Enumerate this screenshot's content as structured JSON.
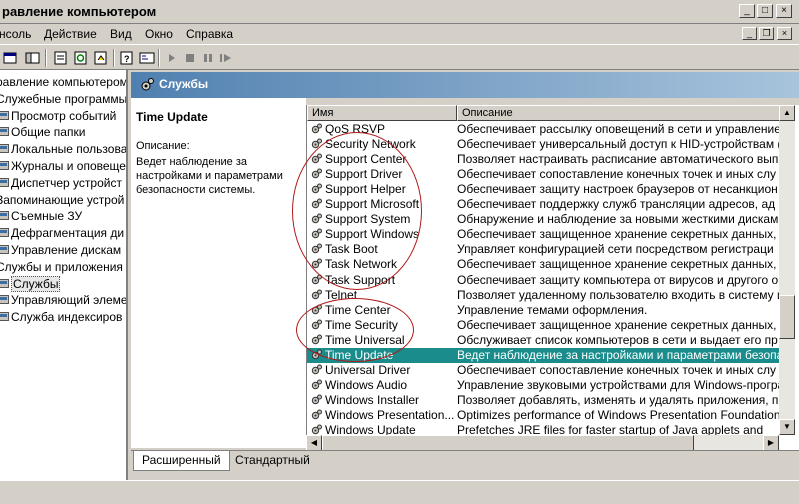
{
  "window": {
    "title": "равление компьютером"
  },
  "menu": {
    "items": [
      "нсоль",
      "Действие",
      "Вид",
      "Окно",
      "Справка"
    ]
  },
  "tree": {
    "items": [
      {
        "label": "равление компьютером",
        "indent": 0
      },
      {
        "label": "Служебные программы",
        "indent": 0
      },
      {
        "label": "Просмотр событий",
        "indent": 1
      },
      {
        "label": "Общие папки",
        "indent": 1
      },
      {
        "label": "Локальные пользова",
        "indent": 1
      },
      {
        "label": "Журналы и оповеще",
        "indent": 1
      },
      {
        "label": "Диспетчер устройст",
        "indent": 1
      },
      {
        "label": "Запоминающие устрой",
        "indent": 0
      },
      {
        "label": "Съемные ЗУ",
        "indent": 1
      },
      {
        "label": "Дефрагментация ди",
        "indent": 1
      },
      {
        "label": "Управление дискам",
        "indent": 1
      },
      {
        "label": "Службы и приложения",
        "indent": 0
      },
      {
        "label": "Службы",
        "indent": 1,
        "selected": true
      },
      {
        "label": "Управляющий элеме",
        "indent": 1
      },
      {
        "label": "Служба индексиров",
        "indent": 1
      }
    ]
  },
  "panel": {
    "title": "Службы"
  },
  "description": {
    "title": "Time Update",
    "label": "Описание:",
    "text": "Ведет наблюдение за настройками и параметрами безопасности системы."
  },
  "list": {
    "columns": [
      "Имя",
      "Описание"
    ],
    "rows": [
      {
        "name": "QoS RSVP",
        "desc": "Обеспечивает рассылку оповещений в сети и управление"
      },
      {
        "name": "Security Network",
        "desc": "Обеспечивает универсальный доступ к HID-устройствам ("
      },
      {
        "name": "Support Center",
        "desc": "Позволяет настраивать расписание автоматического вып"
      },
      {
        "name": "Support Driver",
        "desc": "Обеспечивает сопоставление конечных точек и иных слу"
      },
      {
        "name": "Support Helper",
        "desc": "Обеспечивает защиту настроек браузеров от несанкцион"
      },
      {
        "name": "Support Microsoft",
        "desc": "Обеспечивает поддержку служб трансляции адресов, ад"
      },
      {
        "name": "Support System",
        "desc": "Обнаружение и наблюдение за новыми жесткими дискам"
      },
      {
        "name": "Support Windows",
        "desc": "Обеспечивает защищенное хранение секретных данных,"
      },
      {
        "name": "Task Boot",
        "desc": "Управляет конфигурацией сети посредством регистраци"
      },
      {
        "name": "Task Network",
        "desc": "Обеспечивает защищенное хранение секретных данных,"
      },
      {
        "name": "Task Support",
        "desc": "Обеспечивает защиту компьютера от вирусов и другого о"
      },
      {
        "name": "Telnet",
        "desc": "Позволяет удаленному пользователю входить в систему и"
      },
      {
        "name": "Time Center",
        "desc": "Управление темами оформления."
      },
      {
        "name": "Time Security",
        "desc": "Обеспечивает защищенное хранение секретных данных,"
      },
      {
        "name": "Time Universal",
        "desc": "Обслуживает список компьютеров в сети и выдает его пр"
      },
      {
        "name": "Time Update",
        "desc": "Ведет наблюдение за настройками и параметрами безопа",
        "selected": true
      },
      {
        "name": "Universal Driver",
        "desc": "Обеспечивает сопоставление конечных точек и иных слу"
      },
      {
        "name": "Windows Audio",
        "desc": "Управление звуковыми устройствами для Windows-програ"
      },
      {
        "name": "Windows Installer",
        "desc": "Позволяет добавлять, изменять и удалять приложения, п"
      },
      {
        "name": "Windows Presentation...",
        "desc": "Optimizes performance of Windows Presentation Foundation"
      },
      {
        "name": "Windows Update",
        "desc": "Prefetches JRE files for faster startup of Java applets and"
      }
    ]
  },
  "tabs": [
    "Расширенный",
    "Стандартный"
  ],
  "colors": {
    "selection": "#1a8c8c",
    "annotation": "#b01818"
  }
}
